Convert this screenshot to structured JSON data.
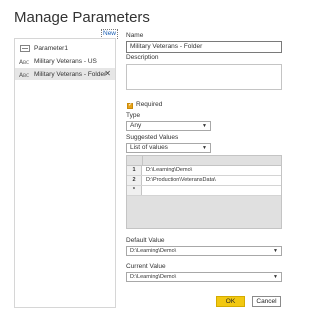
{
  "dialog": {
    "title": "Manage Parameters"
  },
  "list": {
    "new_label": "New",
    "items": [
      {
        "label": "Parameter1",
        "icon": "parameter-icon"
      },
      {
        "label": "Military Veterans - US",
        "icon": "text-parameter-icon"
      },
      {
        "label": "Military Veterans - Folder",
        "icon": "text-parameter-icon",
        "selected": true
      }
    ],
    "remove_glyph": "✕"
  },
  "form": {
    "name_label": "Name",
    "name_value": "Military Veterans - Folder",
    "description_label": "Description",
    "description_value": "",
    "required_label": "Required",
    "required_checked": true,
    "type_label": "Type",
    "type_value": "Any",
    "suggested_label": "Suggested Values",
    "suggested_value": "List of values",
    "values_table": {
      "rows": [
        {
          "num": "1",
          "value": "D:\\Learning\\Demo\\"
        },
        {
          "num": "2",
          "value": "D:\\Production\\VeteransData\\"
        }
      ],
      "new_row_marker": "*"
    },
    "default_label": "Default Value",
    "default_value": "D:\\Learning\\Demo\\",
    "current_label": "Current Value",
    "current_value": "D:\\Learning\\Demo\\"
  },
  "buttons": {
    "ok": "OK",
    "cancel": "Cancel"
  },
  "colors": {
    "accent": "#F2C811",
    "checkbox": "#E8A317",
    "link": "#1A5FB4"
  }
}
